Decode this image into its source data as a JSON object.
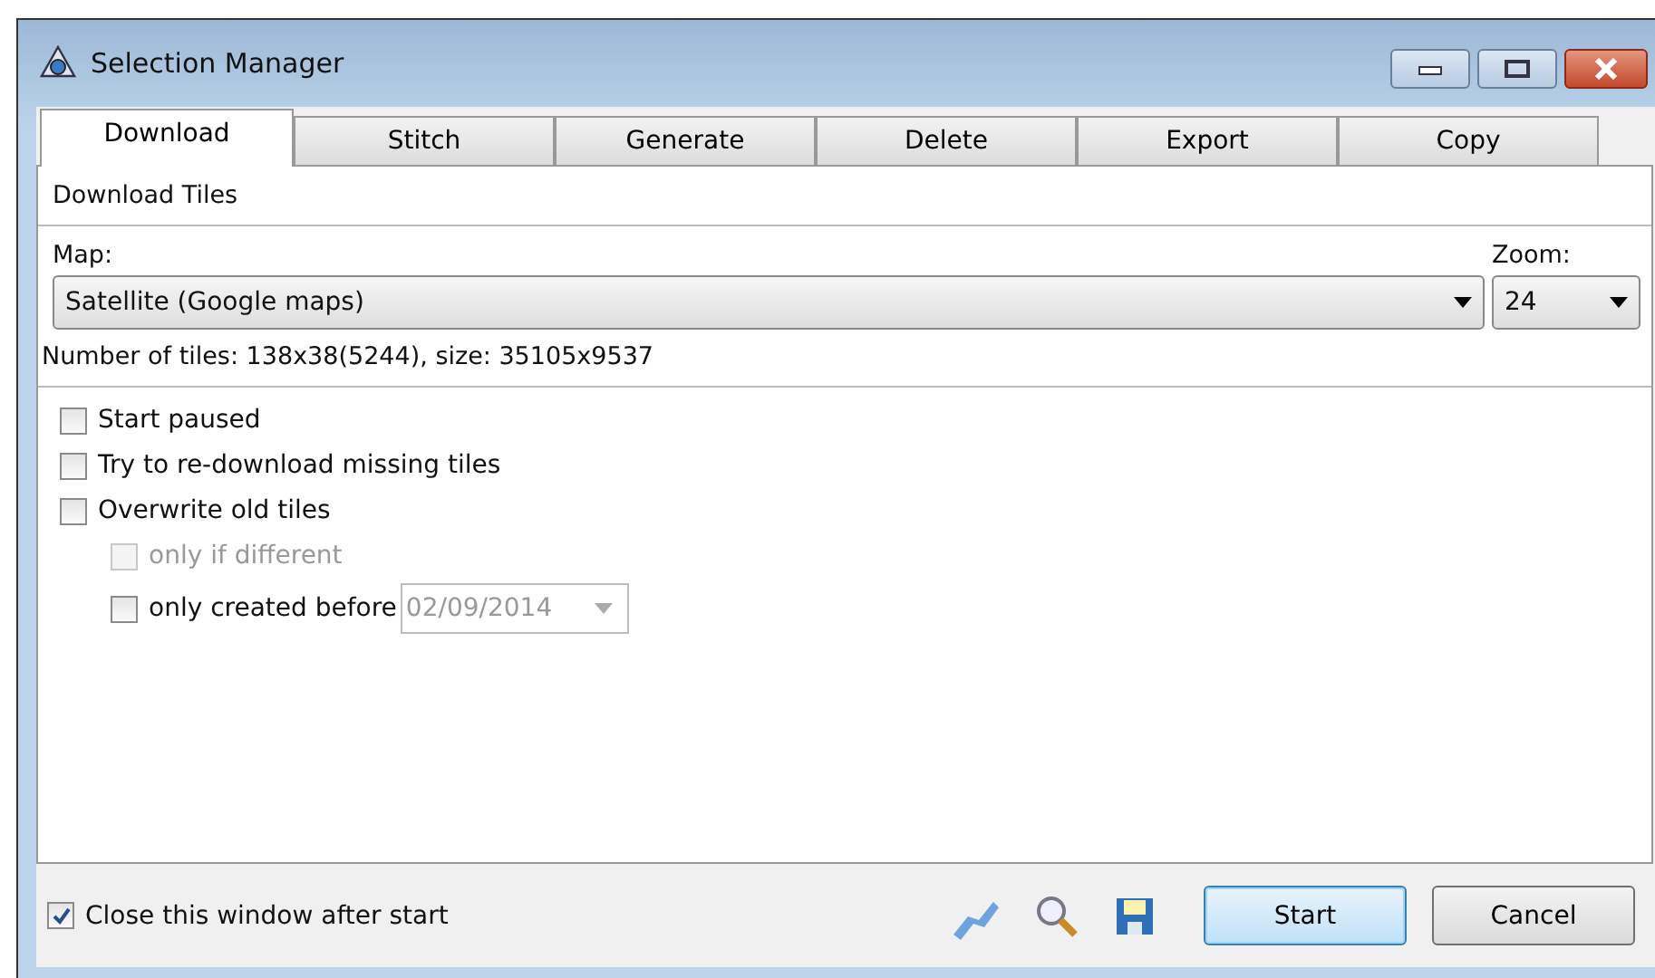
{
  "window": {
    "title": "Selection Manager"
  },
  "tabs": [
    {
      "label": "Download",
      "selected": true
    },
    {
      "label": "Stitch",
      "selected": false
    },
    {
      "label": "Generate",
      "selected": false
    },
    {
      "label": "Delete",
      "selected": false
    },
    {
      "label": "Export",
      "selected": false
    },
    {
      "label": "Copy",
      "selected": false
    }
  ],
  "section_title": "Download Tiles",
  "map": {
    "label": "Map:",
    "value": "Satellite (Google maps)"
  },
  "zoom": {
    "label": "Zoom:",
    "value": "24"
  },
  "tiles_info": "Number of tiles: 138x38(5244), size: 35105x9537",
  "options": [
    {
      "label": "Start paused",
      "checked": false,
      "disabled": false,
      "indented": false
    },
    {
      "label": "Try to re-download missing tiles",
      "checked": false,
      "disabled": false,
      "indented": false
    },
    {
      "label": "Overwrite old tiles",
      "checked": false,
      "disabled": false,
      "indented": false
    },
    {
      "label": "only if different",
      "checked": false,
      "disabled": true,
      "indented": true
    },
    {
      "label": "only created before",
      "checked": false,
      "disabled": false,
      "indented": true,
      "date": "02/09/2014"
    }
  ],
  "close_after_start": {
    "label": "Close this window after start",
    "checked": true
  },
  "buttons": [
    {
      "label": "Start",
      "kind": "default"
    },
    {
      "label": "Cancel",
      "kind": "normal"
    }
  ]
}
